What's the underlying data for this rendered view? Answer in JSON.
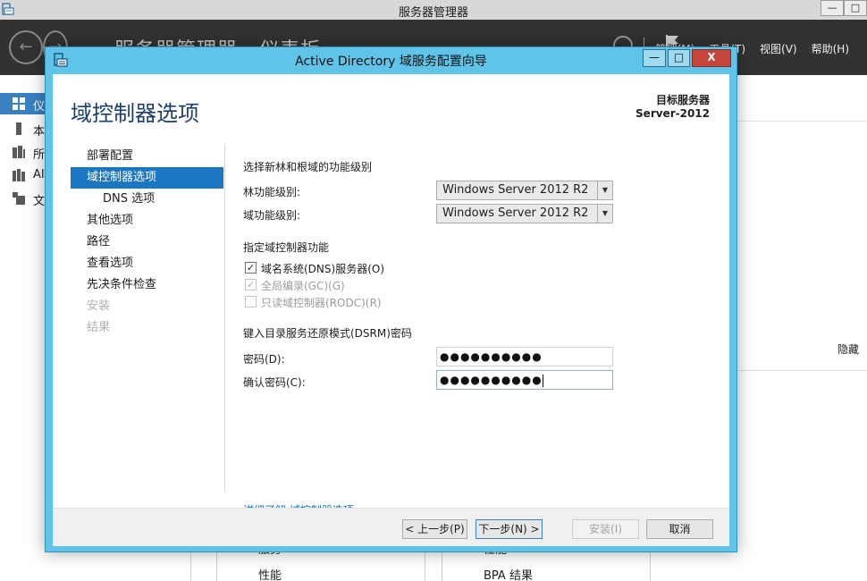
{
  "server_manager": {
    "title": "服务器管理器",
    "breadcrumb": "服务器管理器 · 仪表板",
    "window_controls": {
      "minimize": "—",
      "maximize": "□"
    },
    "menus": [
      {
        "label": "管理(M)"
      },
      {
        "label": "工具(T)"
      },
      {
        "label": "视图(V)"
      },
      {
        "label": "帮助(H)"
      }
    ],
    "sidebar": [
      {
        "label": "仪",
        "icon": "dashboard-icon"
      },
      {
        "label": "本",
        "icon": "local-server-icon"
      },
      {
        "label": "所",
        "icon": "all-servers-icon"
      },
      {
        "label": "AI",
        "icon": "ad-ds-icon"
      },
      {
        "label": "文",
        "icon": "file-services-icon"
      }
    ],
    "hide_label": "隐藏",
    "tiles": {
      "left": {
        "top_label": "服务",
        "bottom_label": "性能"
      },
      "right": {
        "top_label": "性能",
        "bottom_label": "BPA 结果"
      }
    }
  },
  "wizard": {
    "title": "Active Directory 域服务配置向导",
    "window_controls": {
      "minimize": "—",
      "maximize": "□",
      "close": "X"
    },
    "heading": "域控制器选项",
    "target_label": "目标服务器",
    "target_value": "Server-2012",
    "nav": [
      {
        "label": "部署配置",
        "state": "normal"
      },
      {
        "label": "域控制器选项",
        "state": "active"
      },
      {
        "label": "DNS 选项",
        "state": "sub"
      },
      {
        "label": "其他选项",
        "state": "normal"
      },
      {
        "label": "路径",
        "state": "normal"
      },
      {
        "label": "查看选项",
        "state": "normal"
      },
      {
        "label": "先决条件检查",
        "state": "normal"
      },
      {
        "label": "安装",
        "state": "disabled"
      },
      {
        "label": "结果",
        "state": "disabled"
      }
    ],
    "functional_level": {
      "section_label": "选择新林和根域的功能级别",
      "forest_label": "林功能级别:",
      "forest_value": "Windows Server 2012 R2",
      "domain_label": "域功能级别:",
      "domain_value": "Windows Server 2012 R2"
    },
    "dc_capabilities": {
      "section_label": "指定域控制器功能",
      "options": [
        {
          "label": "域名系统(DNS)服务器(O)",
          "checked": true,
          "enabled": true
        },
        {
          "label": "全局编录(GC)(G)",
          "checked": true,
          "enabled": false
        },
        {
          "label": "只读域控制器(RODC)(R)",
          "checked": false,
          "enabled": false
        }
      ]
    },
    "dsrm": {
      "section_label": "键入目录服务还原模式(DSRM)密码",
      "password_label": "密码(D):",
      "password_value": "●●●●●●●●●●",
      "confirm_label": "确认密码(C):",
      "confirm_value": "●●●●●●●●●●"
    },
    "learn_more": "详细了解 域控制器选项",
    "buttons": {
      "previous": "< 上一步(P)",
      "next": "下一步(N) >",
      "install": "安装(I)",
      "cancel": "取消"
    }
  }
}
